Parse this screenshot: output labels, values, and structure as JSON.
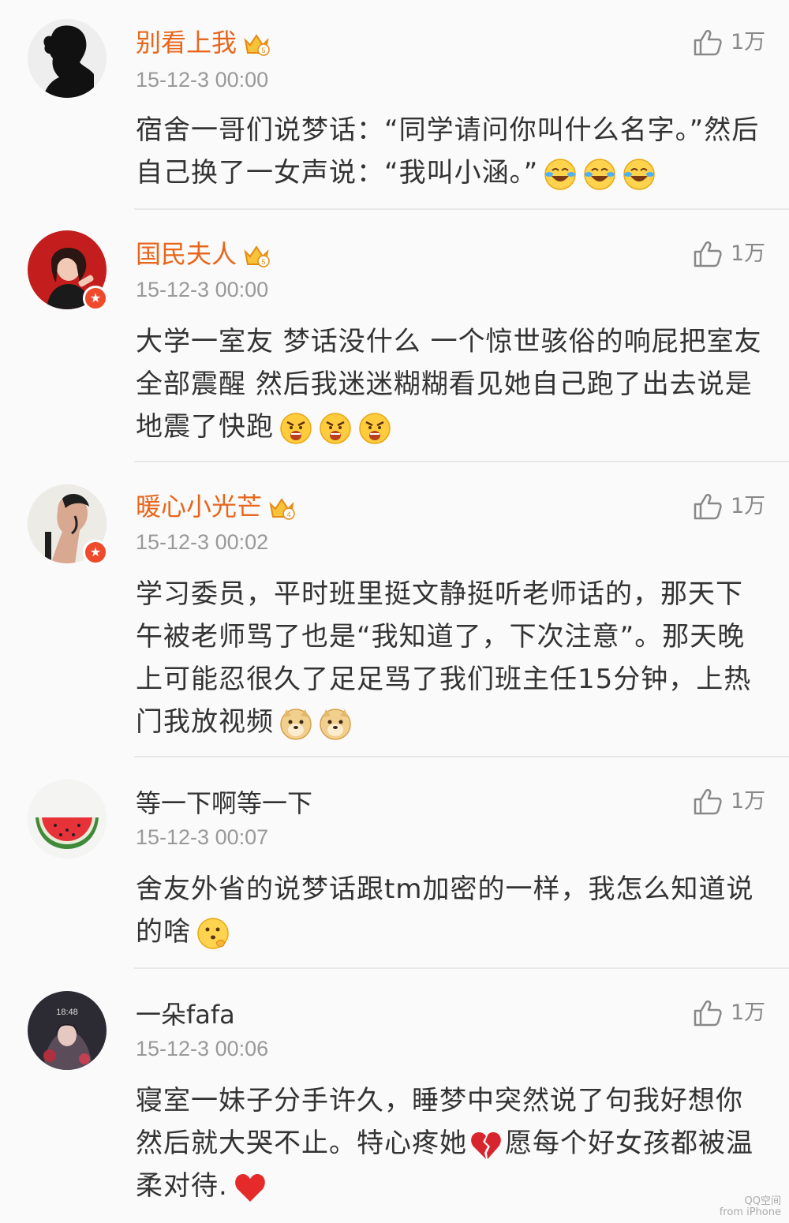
{
  "comments": [
    {
      "username": "别看上我",
      "vip": "5",
      "timestamp": "15-12-3 00:00",
      "likes": "1万",
      "text": "宿舍一哥们说梦话：“同学请问你叫什么名字。”然后自己换了一女声说：“我叫小涵。”",
      "emoji": [
        "laugh-cry",
        "laugh-cry",
        "laugh-cry"
      ]
    },
    {
      "username": "国民夫人",
      "vip": "5",
      "timestamp": "15-12-3 00:00",
      "likes": "1万",
      "text": "大学一室友 梦话没什么 一个惊世骇俗的响屁把室友全部震醒 然后我迷迷糊糊看见她自己跑了出去说是地震了快跑",
      "emoji": [
        "angry",
        "angry",
        "angry"
      ]
    },
    {
      "username": "暖心小光芒",
      "vip": "4",
      "timestamp": "15-12-3 00:02",
      "likes": "1万",
      "text": "学习委员，平时班里挺文静挺听老师话的，那天下午被老师骂了也是“我知道了，下次注意”。那天晚上可能忍很久了足足骂了我们班主任15分钟，上热门我放视频",
      "emoji": [
        "doge",
        "doge"
      ]
    },
    {
      "username": "等一下啊等一下",
      "vip": "",
      "timestamp": "15-12-3 00:07",
      "likes": "1万",
      "text": "舍友外省的说梦话跟tm加密的一样，我怎么知道说的啥",
      "emoji": [
        "thinking"
      ]
    },
    {
      "username": "一朵fafa",
      "vip": "",
      "timestamp": "15-12-3 00:06",
      "likes": "1万",
      "text_a": "寝室一妹子分手许久，睡梦中突然说了句我好想你然后就大哭不止。特心疼她",
      "text_b": "愿每个好女孩都被温柔对待.",
      "emoji": [
        "broken-heart",
        "heart"
      ]
    }
  ],
  "watermark": {
    "line1": "QQ空间",
    "line2": "from iPhone"
  },
  "colors": {
    "vip_name": "#e8661c",
    "timestamp": "#999999",
    "badge": "#f04a2c"
  }
}
